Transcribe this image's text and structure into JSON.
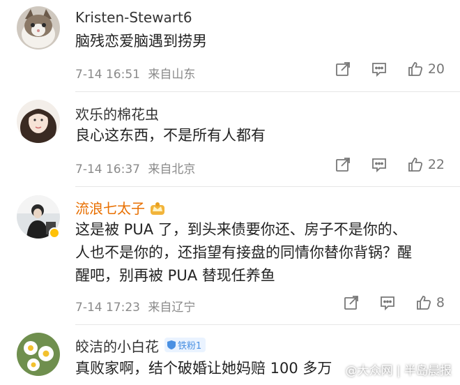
{
  "comments": [
    {
      "username": "Kristen-Stewart6",
      "text": "脑残恋爱脑遇到捞男",
      "time": "7-14 16:51",
      "location": "来自山东",
      "likes": "20"
    },
    {
      "username": "欢乐的棉花虫",
      "text": "良心这东西，不是所有人都有",
      "time": "7-14 16:37",
      "location": "来自北京",
      "likes": "22"
    },
    {
      "username": "流浪七太子",
      "text_lines": [
        "这是被 PUA 了，到头来债要你还、房子不是你的、",
        "人也不是你的，还指望有接盘的同情你替你背锅？醒",
        "醒吧，别再被 PUA 替现任养鱼"
      ],
      "time": "7-14 17:23",
      "location": "来自辽宁",
      "likes": "8"
    },
    {
      "username": "皎洁的小白花",
      "badge": "铁粉1",
      "text": "真败家啊，结个破婚让她妈赔 100 多万"
    }
  ],
  "watermark": "@大众网 | 半岛晨报",
  "colors": {
    "vip_name": "#e86f00",
    "meta_text": "#8a8a8a",
    "icon": "#777777",
    "fan_badge": "#4a90e2"
  },
  "icons": [
    "share-icon",
    "comment-icon",
    "like-icon",
    "crown-badge-icon",
    "shield-icon"
  ]
}
